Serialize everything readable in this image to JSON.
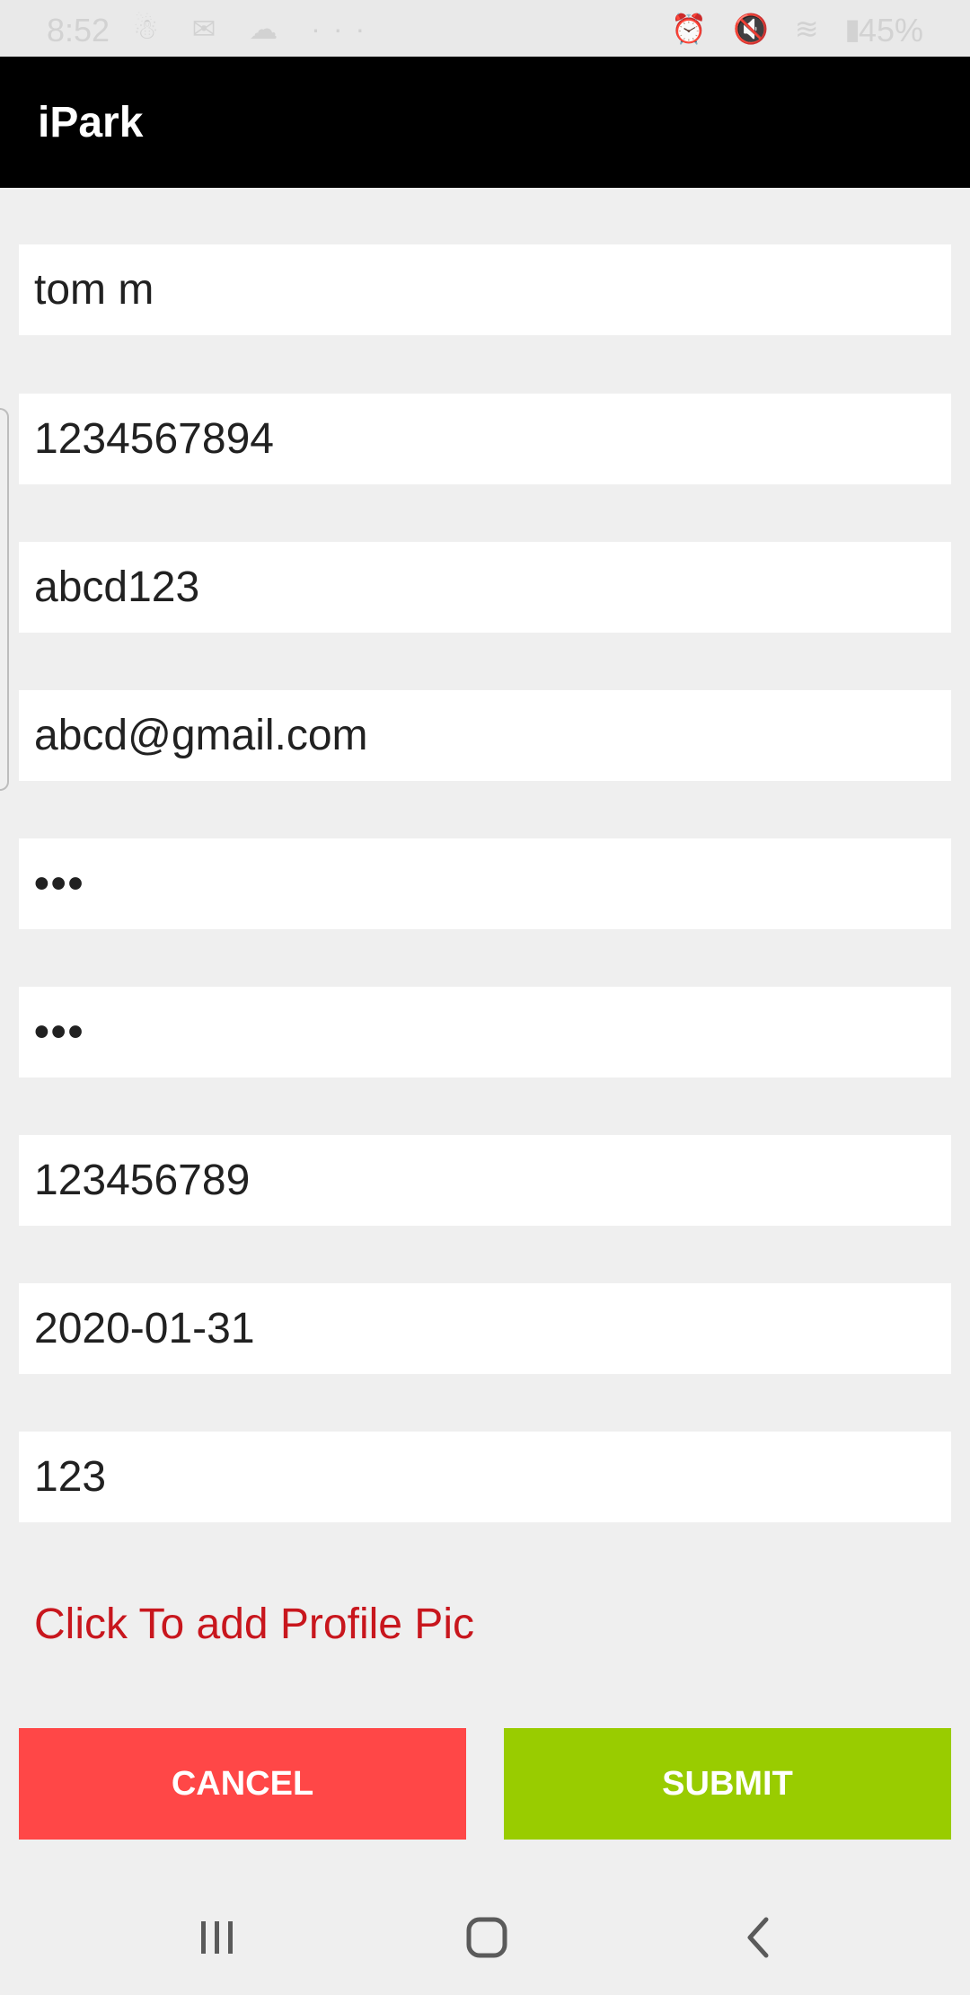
{
  "status_bar": {
    "time": "8:52",
    "left_icons": "☃ ✉ ☁ ···",
    "right_icons": "⏰ 🔇 ≋ ▮",
    "battery": "45%"
  },
  "app_bar": {
    "title": "iPark"
  },
  "form": {
    "fields": [
      {
        "value": "tom m"
      },
      {
        "value": "1234567894"
      },
      {
        "value": "abcd123"
      },
      {
        "value": "abcd@gmail.com"
      },
      {
        "value": "•••"
      },
      {
        "value": "•••"
      },
      {
        "value": "123456789"
      },
      {
        "value": "2020-01-31"
      },
      {
        "value": "123"
      }
    ],
    "profile_pic_link": "Click To add Profile Pic",
    "cancel_label": "CANCEL",
    "submit_label": "SUBMIT"
  },
  "colors": {
    "app_bar": "#000000",
    "cancel": "#ff4747",
    "submit": "#99cc00",
    "link": "#c8161d"
  },
  "nav_bar": {
    "icons": [
      "recent-apps-icon",
      "home-icon",
      "back-icon"
    ]
  }
}
